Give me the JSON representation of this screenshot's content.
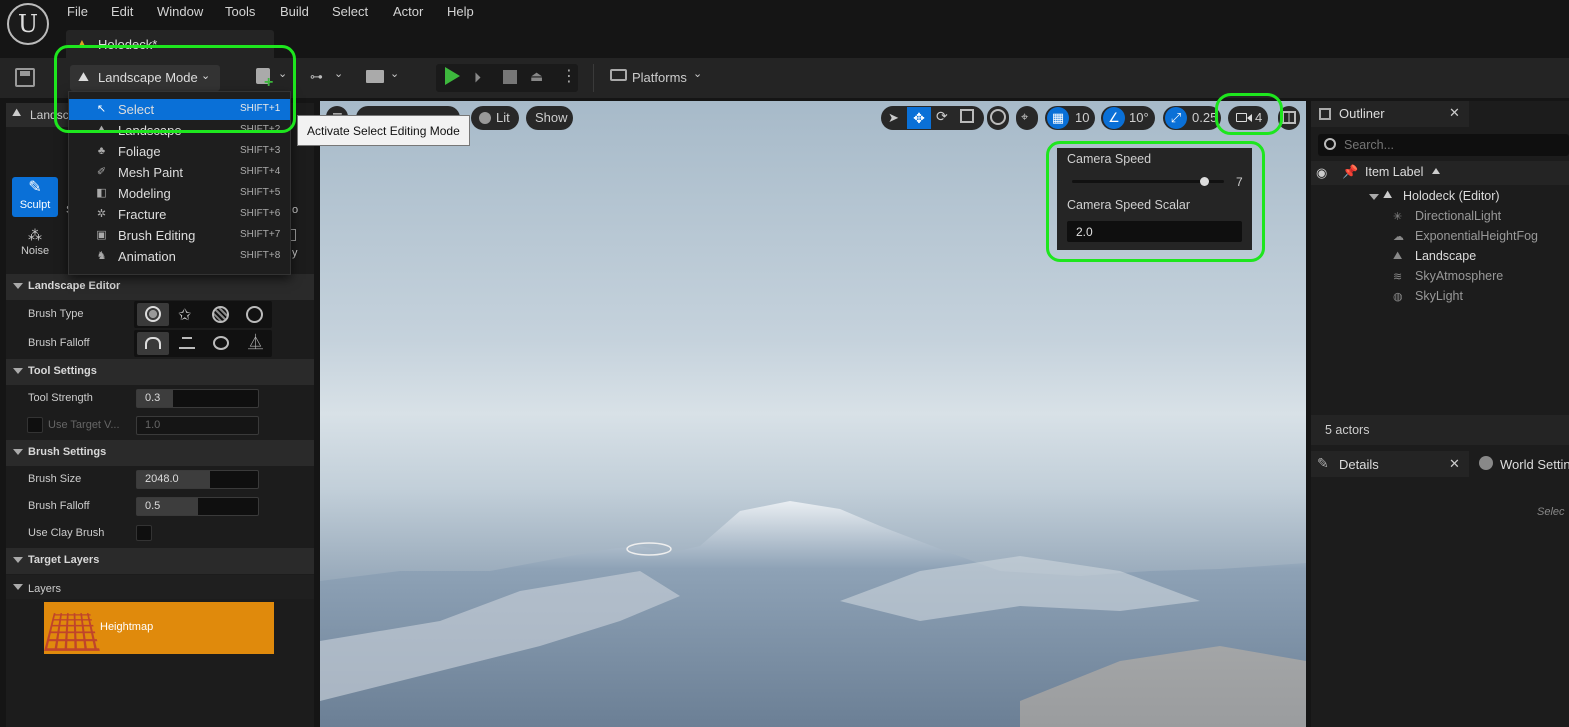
{
  "menubar": {
    "logo": "U",
    "items": [
      "File",
      "Edit",
      "Window",
      "Tools",
      "Build",
      "Select",
      "Actor",
      "Help"
    ],
    "tab_title": "Holodeck*"
  },
  "toolbar": {
    "mode_label": "Landscape Mode",
    "platforms_label": "Platforms"
  },
  "mode_menu": {
    "items": [
      {
        "label": "Select",
        "shortcut": "SHIFT+1",
        "icon": "select-arrow-icon",
        "selected": true
      },
      {
        "label": "Landscape",
        "shortcut": "SHIFT+2",
        "icon": "landscape-icon"
      },
      {
        "label": "Foliage",
        "shortcut": "SHIFT+3",
        "icon": "foliage-icon"
      },
      {
        "label": "Mesh Paint",
        "shortcut": "SHIFT+4",
        "icon": "mesh-paint-icon"
      },
      {
        "label": "Modeling",
        "shortcut": "SHIFT+5",
        "icon": "modeling-icon"
      },
      {
        "label": "Fracture",
        "shortcut": "SHIFT+6",
        "icon": "fracture-icon"
      },
      {
        "label": "Brush Editing",
        "shortcut": "SHIFT+7",
        "icon": "brush-editing-icon"
      },
      {
        "label": "Animation",
        "shortcut": "SHIFT+8",
        "icon": "animation-icon"
      }
    ],
    "tooltip": "Activate Select Editing Mode"
  },
  "left_panel": {
    "tab_label": "Landsc",
    "tools": [
      {
        "label": "Sculpt",
        "active": true
      },
      {
        "label": "Noise",
        "active": false
      }
    ],
    "side_fragments": [
      "S",
      "o",
      "y"
    ],
    "landscape_editor": {
      "header": "Landscape Editor",
      "brush_type_label": "Brush Type",
      "brush_falloff_label": "Brush Falloff"
    },
    "tool_settings": {
      "header": "Tool Settings",
      "tool_strength_label": "Tool Strength",
      "tool_strength_value": "0.3",
      "tool_strength_fill": 0.3,
      "use_target_label": "Use Target V...",
      "use_target_value": "1.0"
    },
    "brush_settings": {
      "header": "Brush Settings",
      "brush_size_label": "Brush Size",
      "brush_size_value": "2048.0",
      "brush_size_fill": 0.6,
      "brush_falloff_label": "Brush Falloff",
      "brush_falloff_value": "0.5",
      "brush_falloff_fill": 0.5,
      "clay_label": "Use Clay Brush"
    },
    "target_layers": {
      "header": "Target Layers",
      "layers_header": "Layers",
      "layer_name": "Heightmap",
      "layer_color": "#e08a0c"
    }
  },
  "viewport": {
    "lit_label": "Lit",
    "show_label": "Show",
    "grid_value": "10",
    "angle_value": "10°",
    "scale_value": "0.25",
    "camera_speed_value": "4",
    "camera_popup": {
      "speed_label": "Camera Speed",
      "speed_value": "7",
      "speed_fraction": 0.87,
      "scalar_label": "Camera Speed Scalar",
      "scalar_value": "2.0"
    }
  },
  "outliner": {
    "title": "Outliner",
    "search_placeholder": "Search...",
    "column_label": "Item Label",
    "root": "Holodeck (Editor)",
    "items": [
      {
        "label": "DirectionalLight",
        "icon": "directional-light-icon",
        "bright": false
      },
      {
        "label": "ExponentialHeightFog",
        "icon": "fog-icon",
        "bright": false
      },
      {
        "label": "Landscape",
        "icon": "landscape-icon",
        "bright": true
      },
      {
        "label": "SkyAtmosphere",
        "icon": "sky-atmosphere-icon",
        "bright": false
      },
      {
        "label": "SkyLight",
        "icon": "skylight-icon",
        "bright": false
      }
    ],
    "actor_count": "5 actors"
  },
  "details": {
    "tab_label": "Details",
    "world_tab_label": "World Settin",
    "select_hint": "Selec"
  },
  "colors": {
    "highlight": "#1ee61e",
    "accent": "#0a70d7",
    "play": "#3db83d"
  }
}
